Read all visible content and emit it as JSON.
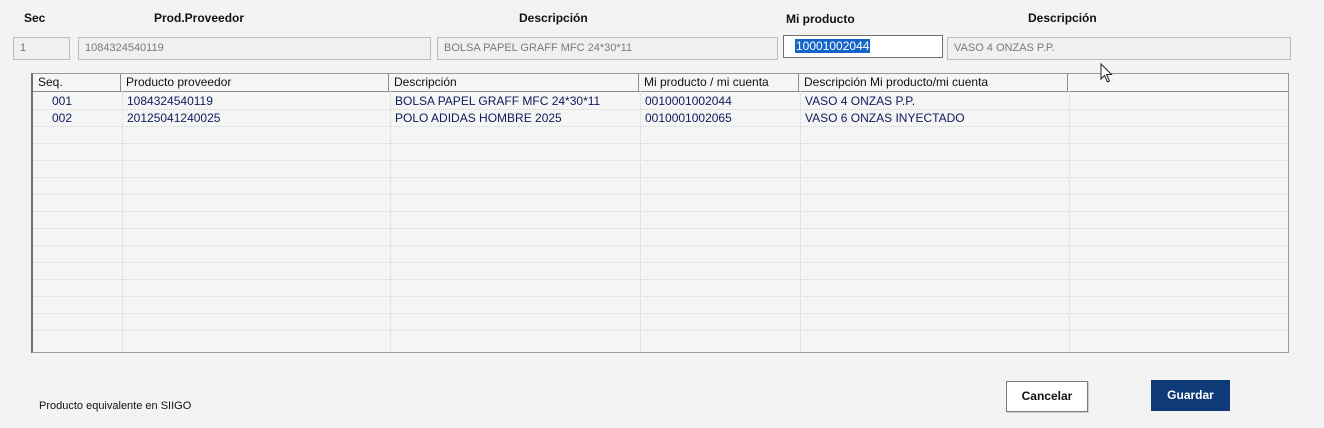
{
  "form": {
    "labels": {
      "sec": "Sec",
      "prod_proveedor": "Prod.Proveedor",
      "descripcion": "Descripción",
      "mi_producto": "Mi producto",
      "descripcion2": "Descripción"
    },
    "fields": {
      "sec": "1",
      "prod_proveedor": "1084324540119",
      "descripcion": "BOLSA PAPEL GRAFF MFC 24*30*11",
      "mi_producto": "10001002044",
      "descripcion2": "VASO 4 ONZAS P.P."
    }
  },
  "grid": {
    "columns": [
      "Seq.",
      "Producto proveedor",
      "Descripción",
      "Mi producto / mi cuenta",
      "Descripción Mi producto/mi cuenta"
    ],
    "rows": [
      {
        "seq": "001",
        "producto_proveedor": "1084324540119",
        "descripcion": "BOLSA PAPEL GRAFF MFC 24*30*11",
        "mi_producto": "0010001002044",
        "descripcion_mi_producto": "VASO 4 ONZAS P.P."
      },
      {
        "seq": "002",
        "producto_proveedor": "20125041240025",
        "descripcion": "POLO ADIDAS HOMBRE 2025",
        "mi_producto": "0010001002065",
        "descripcion_mi_producto": "VASO 6 ONZAS INYECTADO"
      }
    ]
  },
  "footer": {
    "label": "Producto equivalente en SIIGO",
    "cancel_label": "Cancelar",
    "save_label": "Guardar"
  },
  "colors": {
    "save_button": "#0e3a77",
    "selection": "#1565c8",
    "grid_text": "#0c1a5c"
  },
  "icons": {
    "cursor": "mouse-pointer-icon"
  }
}
